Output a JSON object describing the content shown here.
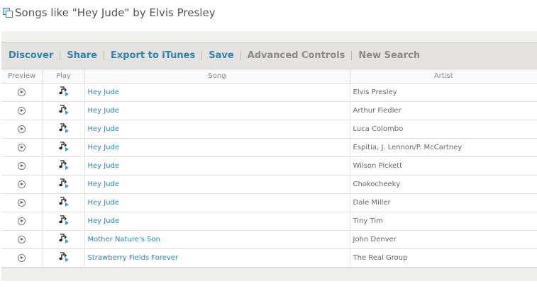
{
  "page": {
    "title": "Songs like \"Hey Jude\" by Elvis Presley"
  },
  "toolbar": {
    "items": [
      {
        "label": "Discover",
        "style": "link"
      },
      {
        "label": "Share",
        "style": "link"
      },
      {
        "label": "Export to iTunes",
        "style": "link"
      },
      {
        "label": "Save",
        "style": "link"
      },
      {
        "label": "Advanced Controls",
        "style": "muted"
      },
      {
        "label": "New Search",
        "style": "muted"
      }
    ]
  },
  "table": {
    "headers": {
      "preview": "Preview",
      "play": "Play",
      "song": "Song",
      "artist": "Artist"
    },
    "rows": [
      {
        "song": "Hey Jude",
        "artist": "Elvis Presley"
      },
      {
        "song": "Hey Jude",
        "artist": "Arthur Fiedler"
      },
      {
        "song": "Hey Jude",
        "artist": "Luca Colombo"
      },
      {
        "song": "Hey Jude",
        "artist": "Espitia, J. Lennon/P. McCartney"
      },
      {
        "song": "Hey Jude",
        "artist": "Wilson Pickett"
      },
      {
        "song": "Hey Jude",
        "artist": "Chokocheeky"
      },
      {
        "song": "Hey Jude",
        "artist": "Dale Miller"
      },
      {
        "song": "Hey Jude",
        "artist": "Tiny Tim"
      },
      {
        "song": "Mother Nature's Son",
        "artist": "John Denver"
      },
      {
        "song": "Strawberry Fields Forever",
        "artist": "The Real Group"
      }
    ]
  },
  "icons": {
    "title": "playlist-icon",
    "preview": "preview-play-icon",
    "play": "add-to-player-icon"
  },
  "colors": {
    "link": "#2d83b8",
    "muted": "#8a8a8a",
    "toolbar_bg": "#e4e3e0"
  }
}
